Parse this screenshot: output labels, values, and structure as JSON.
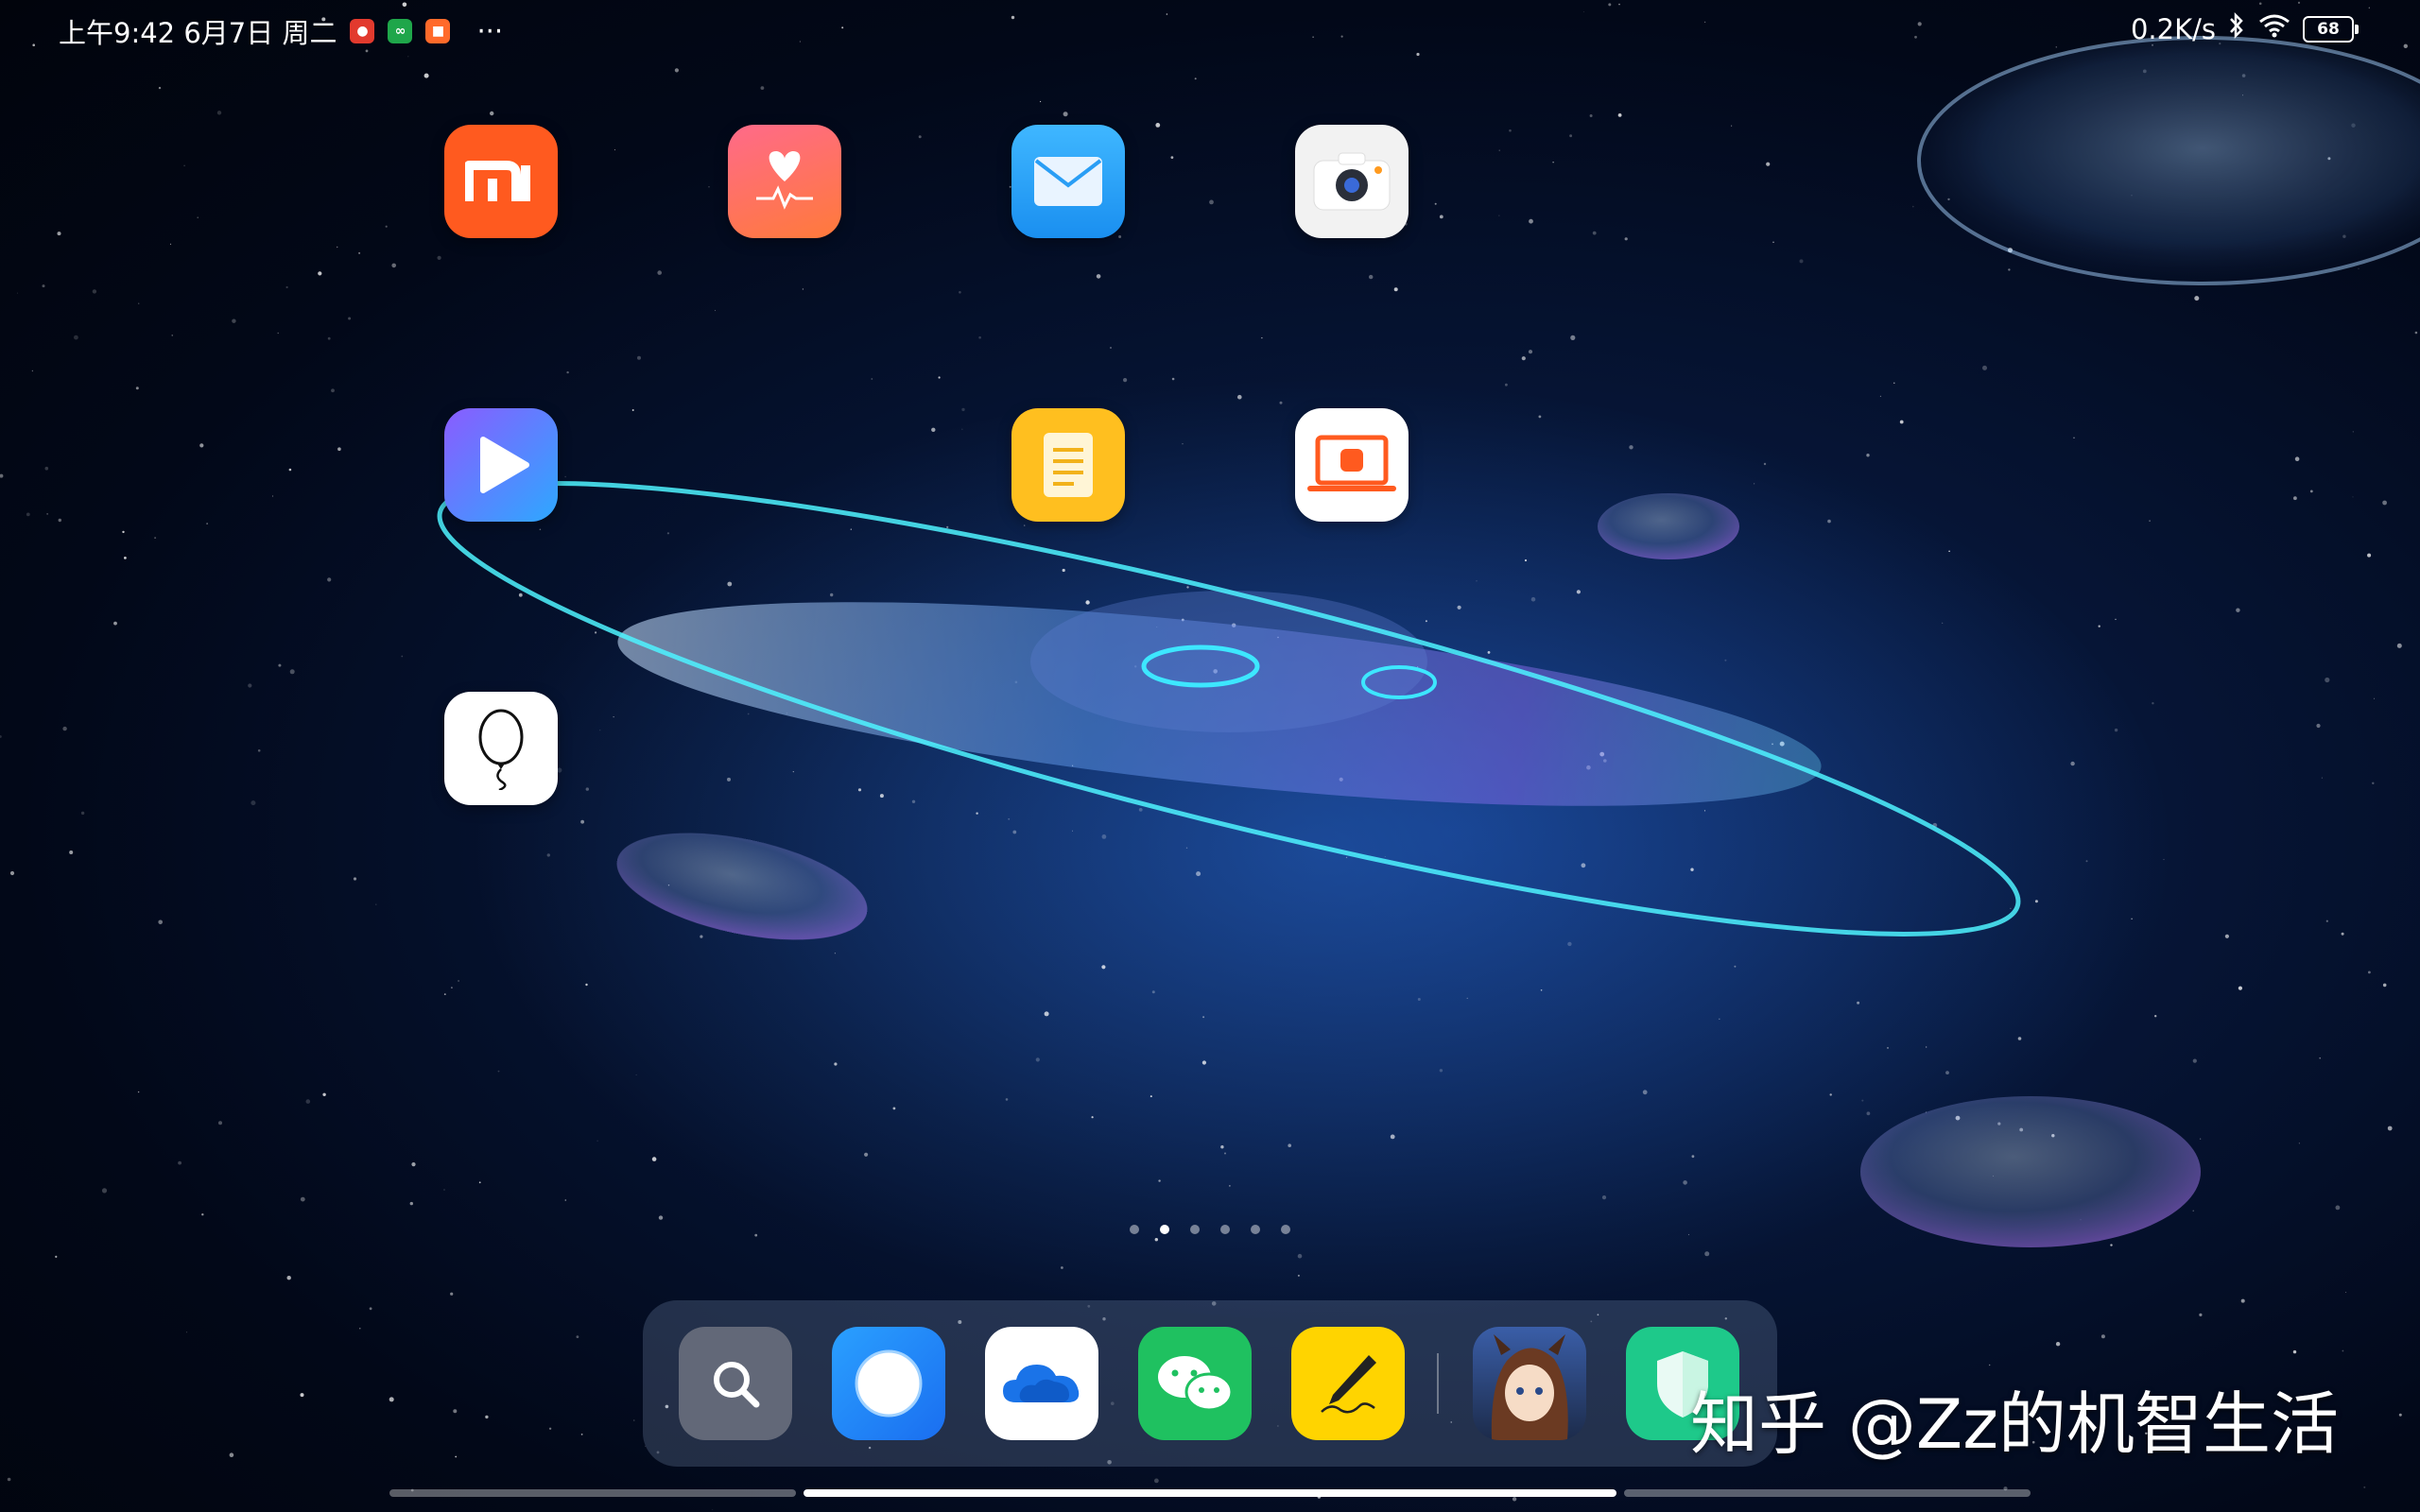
{
  "status_bar": {
    "time_date": "上午9:42 6月7日 周二",
    "more_label": "···",
    "network_speed": "0.2K/s",
    "battery_level": "68",
    "notification_icons": [
      "red-app-notification-icon",
      "green-app-notification-icon",
      "orange-video-notification-icon"
    ]
  },
  "home_screen": {
    "apps": [
      {
        "name": "mi-store",
        "color": "#ff5a1f"
      },
      {
        "name": "health",
        "color": "#ff4d6d"
      },
      {
        "name": "mail",
        "color": "#2aa8f5"
      },
      {
        "name": "camera",
        "color": "#f2f2f2"
      },
      {
        "name": "video",
        "color": "#7b5cff"
      },
      {
        "name": "notes",
        "color": "#ffbf1f"
      },
      {
        "name": "mi-pc-connect",
        "color": "#ffffff"
      },
      {
        "name": "balloon",
        "color": "#ffffff"
      }
    ],
    "page_count": 6,
    "active_page": 2
  },
  "dock": {
    "apps": [
      {
        "name": "search",
        "color": "#6b7180"
      },
      {
        "name": "browser",
        "color": "#1e8fff"
      },
      {
        "name": "onedrive",
        "color": "#ffffff"
      },
      {
        "name": "wechat",
        "color": "#1fc160"
      },
      {
        "name": "pen-notes",
        "color": "#ffd400"
      },
      {
        "name": "game",
        "color": "#2c3f6a"
      },
      {
        "name": "security",
        "color": "#1ec98a"
      }
    ]
  },
  "watermark": "知乎 @Zz的机智生活"
}
